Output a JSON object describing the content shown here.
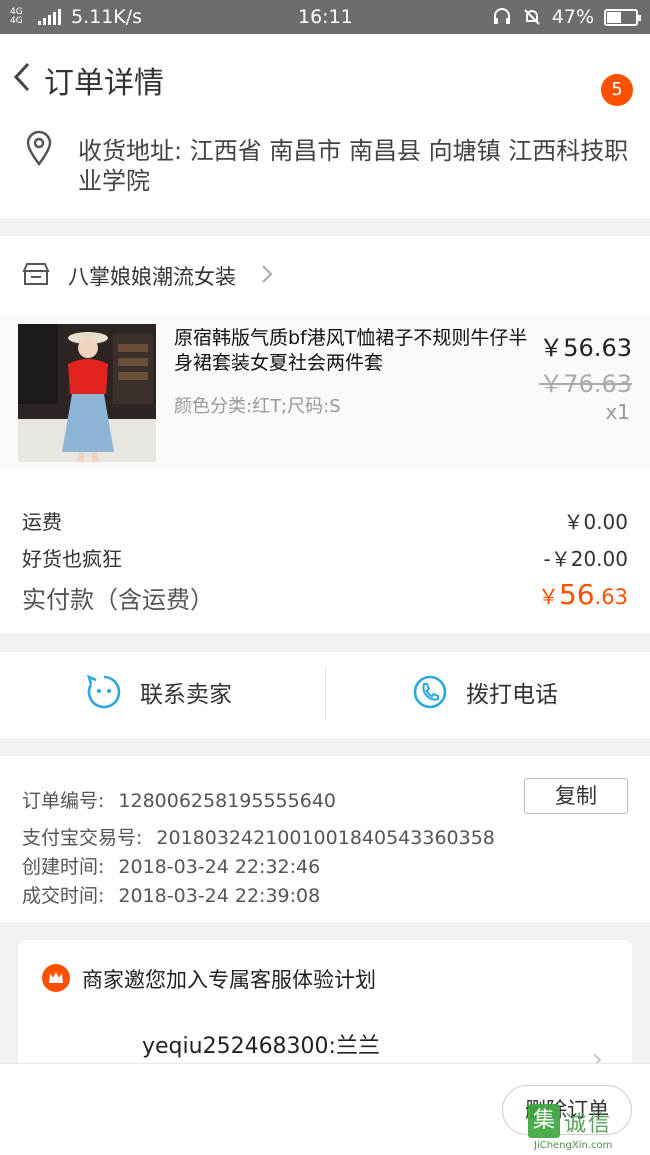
{
  "status_bar": {
    "network": "4G 4G",
    "speed": "5.11K/s",
    "time": "16:11",
    "battery": "47%",
    "battery_fraction": 0.47
  },
  "nav": {
    "title": "订单详情",
    "badge_count": "5"
  },
  "address": {
    "label_line": "收货地址: 江西省 南昌市 南昌县 向塘镇 江西科技职业学院"
  },
  "shop": {
    "name": "八掌娘娘潮流女装"
  },
  "item": {
    "title": "原宿韩版气质bf港风T恤裙子不规则牛仔半身裙套装女夏社会两件套",
    "spec": "颜色分类:红T;尺码:S",
    "price": "￥56.63",
    "original_price": "￥76.63",
    "quantity": "x1"
  },
  "fees": {
    "shipping_label": "运费",
    "shipping_value": "￥0.00",
    "discount_label": "好货也疯狂",
    "discount_value": "-￥20.00",
    "total_label": "实付款（含运费）",
    "total_currency": "￥",
    "total_int": "56",
    "total_dec": ".63"
  },
  "contact": {
    "seller_label": "联系卖家",
    "phone_label": "拨打电话"
  },
  "order_info": {
    "order_no_label": "订单编号:",
    "order_no": "128006258195555640",
    "copy_label": "复制",
    "alipay_label": "支付宝交易号:",
    "alipay_no": "2018032421001001840543360358",
    "created_label": "创建时间:",
    "created": "2018-03-24 22:32:46",
    "deal_label": "成交时间:",
    "deal": "2018-03-24 22:39:08"
  },
  "invite": {
    "title": "商家邀您加入专属客服体验计划",
    "user": "yeqiu252468300:兰兰"
  },
  "bottom": {
    "delete_label": "删除订单"
  },
  "watermark": {
    "box": "集",
    "cn": "诚信",
    "en": "JiChengXin.com"
  },
  "colors": {
    "accent": "#ff5000",
    "link_blue": "#2ea7e0"
  }
}
